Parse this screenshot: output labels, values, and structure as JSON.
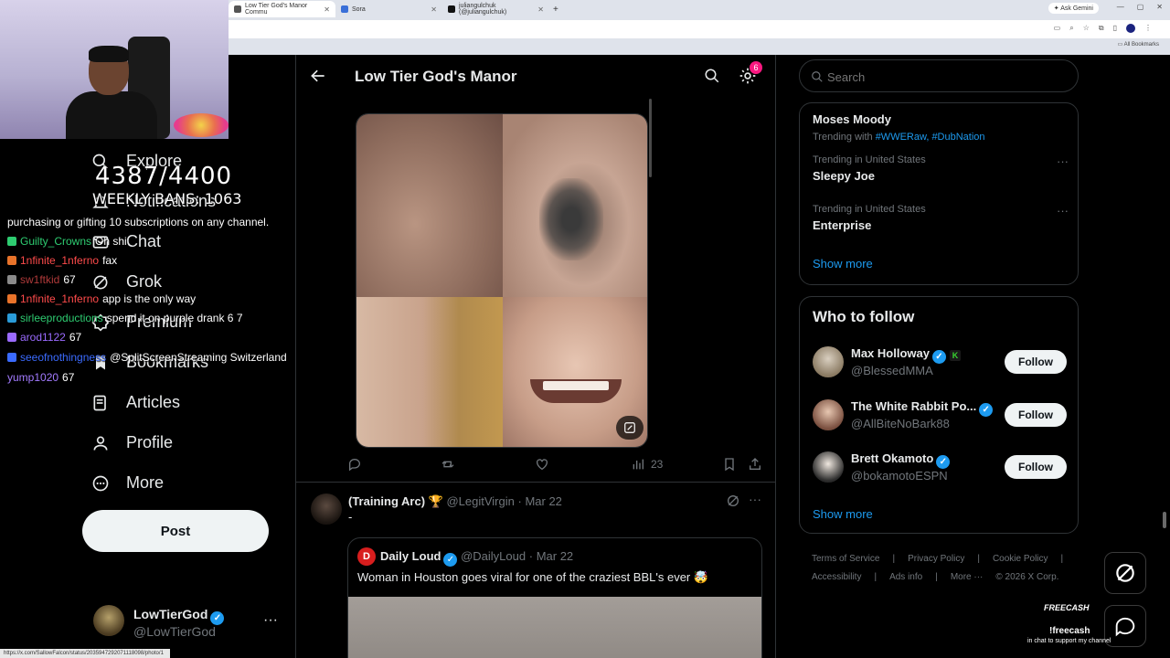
{
  "browser": {
    "tabs": [
      {
        "label": "Low Tier God's Manor Commu"
      },
      {
        "label": "Sora"
      },
      {
        "label": "juliangulchuk (@juliangulchuk)"
      }
    ],
    "new_tab": "+",
    "ask_gemini": "Ask Gemini",
    "all_bookmarks": "All Bookmarks",
    "status_url": "https://x.com/SallowFalcon/status/2035947292071118098/photo/1"
  },
  "overlay": {
    "count": "4387/4400",
    "weekly": "WEEKLY BANS: 1063",
    "chat": [
      {
        "user": "",
        "msg": "purchasing or gifting 10 subscriptions on any channel.",
        "user_color": "#ffffff",
        "badge": ""
      },
      {
        "user": "Guilty_Crowns",
        "msg": "Oh shi",
        "user_color": "#2ecc71",
        "badge": "#2ecc71"
      },
      {
        "user": "1nfinite_1nferno",
        "msg": "fax",
        "user_color": "#ff4b4b",
        "badge": "#e8732a"
      },
      {
        "user": "sw1ftkid",
        "msg": "67",
        "user_color": "#b03a3a",
        "badge": "#8a8a8a"
      },
      {
        "user": "1nfinite_1nferno",
        "msg": "app is the only way",
        "user_color": "#ff4b4b",
        "badge": "#e8732a"
      },
      {
        "user": "sirleeproductions",
        "msg": "spend it on purple drank 6 7",
        "user_color": "#2ecc71",
        "badge": "#2a9bd8"
      },
      {
        "user": "arod1122",
        "msg": "67",
        "user_color": "#9b6bff",
        "badge": "#9b6bff"
      },
      {
        "user": "seeofnothingness",
        "msg": "@SplitScreenStreaming Switzerland",
        "user_color": "#3b6bff",
        "badge": "#3b6bff"
      },
      {
        "user": "yump1020",
        "msg": "67",
        "user_color": "#a37bff",
        "badge": ""
      }
    ]
  },
  "nav": {
    "items": [
      {
        "label": "Explore",
        "icon": "search-icon"
      },
      {
        "label": "Notifications",
        "icon": "bell-icon"
      },
      {
        "label": "Chat",
        "icon": "mail-icon"
      },
      {
        "label": "Grok",
        "icon": "grok-icon"
      },
      {
        "label": "Premium",
        "icon": "premium-icon"
      },
      {
        "label": "Bookmarks",
        "icon": "bookmark-icon"
      },
      {
        "label": "Articles",
        "icon": "articles-icon"
      },
      {
        "label": "Profile",
        "icon": "profile-icon"
      },
      {
        "label": "More",
        "icon": "more-icon"
      }
    ],
    "post_label": "Post"
  },
  "account": {
    "name": "LowTierGod",
    "handle": "@LowTierGod",
    "dots": "···"
  },
  "main": {
    "title": "Low Tier God's Manor",
    "settings_badge": "6",
    "tweet1": {
      "views": "23"
    },
    "tweet2": {
      "name": "(Training Arc) 🏆",
      "handle": "@LegitVirgin",
      "date": "Mar 22",
      "text": "-",
      "more": "···",
      "quote": {
        "name": "Daily Loud",
        "handle": "@DailyLoud",
        "date": "Mar 22",
        "text": "Woman in Houston goes viral for one of the craziest BBL's ever 🤯"
      }
    }
  },
  "right": {
    "search_placeholder": "Search",
    "trends": [
      {
        "context": "",
        "name": "Moses Moody",
        "with_prefix": "Trending with",
        "tags": [
          "#WWERaw",
          "#DubNation"
        ]
      },
      {
        "context": "Trending in United States",
        "name": "Sleepy Joe"
      },
      {
        "context": "Trending in United States",
        "name": "Enterprise"
      }
    ],
    "show_more": "Show more",
    "who_to_follow": {
      "title": "Who to follow",
      "accounts": [
        {
          "name": "Max Holloway",
          "handle": "@BlessedMMA",
          "button": "Follow"
        },
        {
          "name": "The White Rabbit Po...",
          "handle": "@AllBiteNoBark88",
          "button": "Follow"
        },
        {
          "name": "Brett Okamoto",
          "handle": "@bokamotoESPN",
          "button": "Follow"
        }
      ],
      "show_more": "Show more"
    },
    "footer": [
      "Terms of Service",
      "|",
      "Privacy Policy",
      "|",
      "Cookie Policy",
      "|",
      "Accessibility",
      "|",
      "Ads info",
      "|",
      "More ···",
      "© 2026 X Corp."
    ]
  },
  "promo": {
    "brand": "FREECASH",
    "command": "!freecash",
    "sub": "in chat to support my channel"
  },
  "colors": {
    "accent": "#1d9bf0",
    "background": "#000000",
    "badge_pink": "#f91880"
  }
}
